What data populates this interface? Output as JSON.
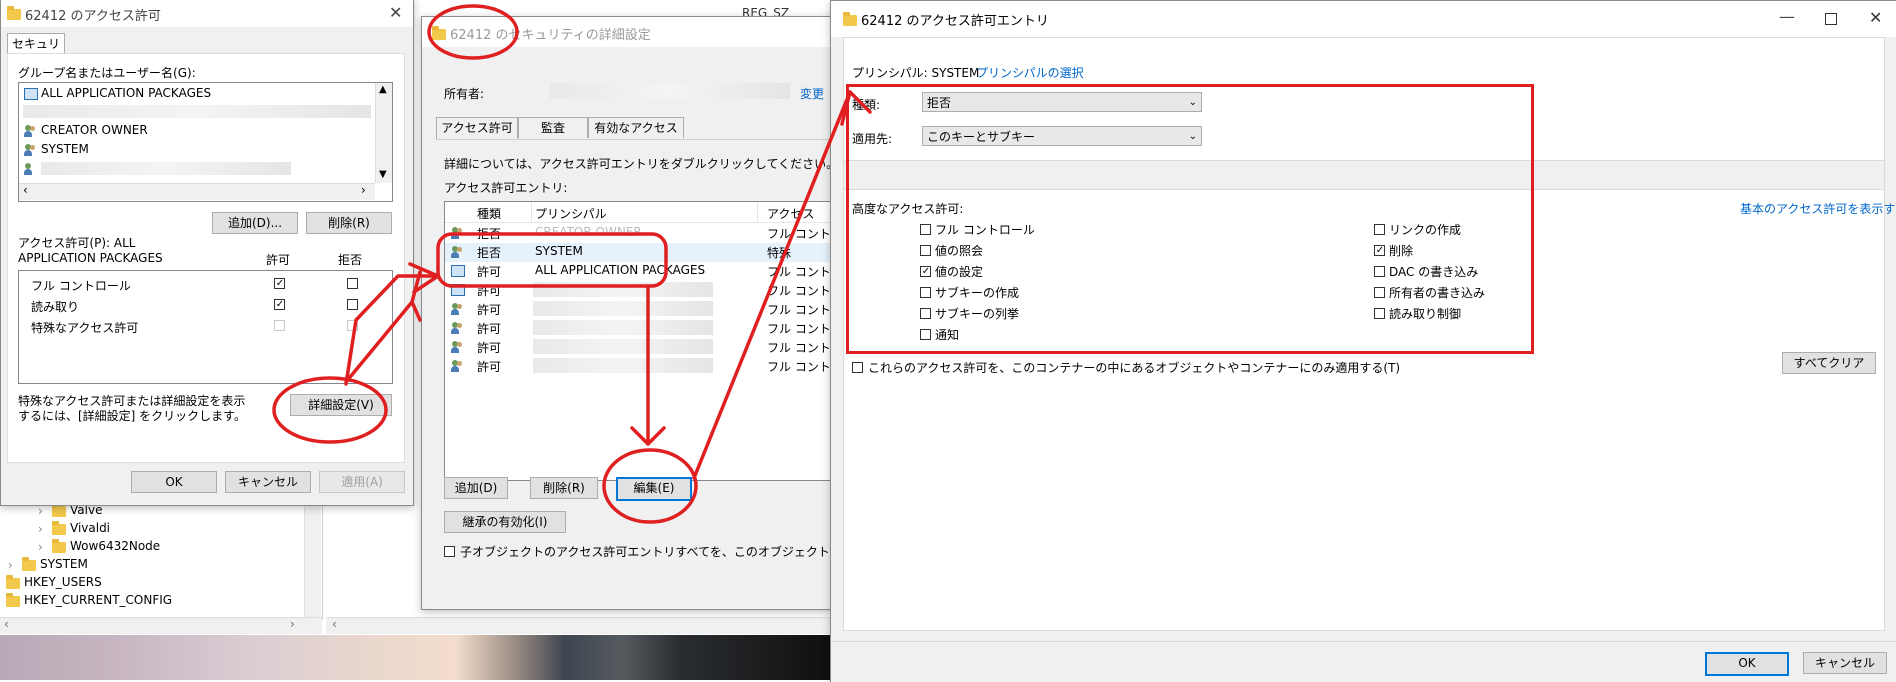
{
  "perm_dialog": {
    "title": "62412 のアクセス許可",
    "tab": "セキュリティ",
    "group_label": "グループ名またはユーザー名(G):",
    "users": [
      "ALL APPLICATION PACKAGES",
      "CREATOR OWNER",
      "SYSTEM"
    ],
    "add_button": "追加(D)...",
    "remove_button": "削除(R)",
    "perm_header": "アクセス許可(P): ALL APPLICATION PACKAGES",
    "allow_col": "許可",
    "deny_col": "拒否",
    "perms": [
      {
        "label": "フル コントロール",
        "allow": true,
        "deny": false
      },
      {
        "label": "読み取り",
        "allow": true,
        "deny": false
      },
      {
        "label": "特殊なアクセス許可",
        "allow": false,
        "deny": false
      }
    ],
    "hint": "特殊なアクセス許可または詳細設定を表示するには、[詳細設定] をクリックします。",
    "advanced_button": "詳細設定(V)",
    "ok": "OK",
    "cancel": "キャンセル",
    "apply": "適用(A)"
  },
  "tree": {
    "items": [
      "Valve",
      "Vivaldi",
      "Wow6432Node",
      "SYSTEM",
      "HKEY_USERS",
      "HKEY_CURRENT_CONFIG"
    ]
  },
  "regsz": "REG_SZ",
  "adv_dialog": {
    "title": "62412 のセキュリティの詳細設定",
    "owner_label": "所有者:",
    "change_link": "変更",
    "tabs": [
      "アクセス許可",
      "監査",
      "有効なアクセス"
    ],
    "info": "詳細については、アクセス許可エントリをダブルクリックしてください。アクセス許",
    "entries_label": "アクセス許可エントリ:",
    "columns": [
      "種類",
      "プリンシパル",
      "アクセス"
    ],
    "rows": [
      {
        "type": "拒否",
        "principal": "CREATOR OWNER",
        "access": "フル コントロール"
      },
      {
        "type": "拒否",
        "principal": "SYSTEM",
        "access": "特殊"
      },
      {
        "type": "許可",
        "principal": "ALL APPLICATION PACKAGES",
        "access": "フル コントロール"
      },
      {
        "type": "許可",
        "principal": "",
        "access": "フル コントロール"
      },
      {
        "type": "許可",
        "principal": "",
        "access": "フル コントロール"
      },
      {
        "type": "許可",
        "principal": "",
        "access": "フル コントロール"
      },
      {
        "type": "許可",
        "principal": "",
        "access": "フル コントロール"
      },
      {
        "type": "許可",
        "principal": "",
        "access": "フル コントロール"
      }
    ],
    "add_button": "追加(D)",
    "remove_button": "削除(R)",
    "edit_button": "編集(E)",
    "inherit_button": "継承の有効化(I)",
    "replace_label": "子オブジェクトのアクセス許可エントリすべてを、このオブジェクトからの継承"
  },
  "entry_dialog": {
    "title": "62412 のアクセス許可エントリ",
    "principal_label": "プリンシパル: SYSTEM",
    "principal_link": "プリンシパルの選択",
    "type_label": "種類:",
    "type_value": "拒否",
    "applies_label": "適用先:",
    "applies_value": "このキーとサブキー",
    "adv_label": "高度なアクセス許可:",
    "basic_link": "基本のアクセス許可を表示する",
    "left_perms": [
      {
        "label": "フル コントロール",
        "checked": false
      },
      {
        "label": "値の照会",
        "checked": false
      },
      {
        "label": "値の設定",
        "checked": true
      },
      {
        "label": "サブキーの作成",
        "checked": false
      },
      {
        "label": "サブキーの列挙",
        "checked": false
      },
      {
        "label": "通知",
        "checked": false
      }
    ],
    "right_perms": [
      {
        "label": "リンクの作成",
        "checked": false
      },
      {
        "label": "削除",
        "checked": true
      },
      {
        "label": "DAC の書き込み",
        "checked": false
      },
      {
        "label": "所有者の書き込み",
        "checked": false
      },
      {
        "label": "読み取り制御",
        "checked": false
      }
    ],
    "container_only": "これらのアクセス許可を、このコンテナーの中にあるオブジェクトやコンテナーにのみ適用する(T)",
    "clear_all": "すべてクリア",
    "ok": "OK",
    "cancel": "キャンセル"
  },
  "colors": {
    "annotation": "#e02020",
    "accent": "#0078d7",
    "link": "#0066cc"
  }
}
